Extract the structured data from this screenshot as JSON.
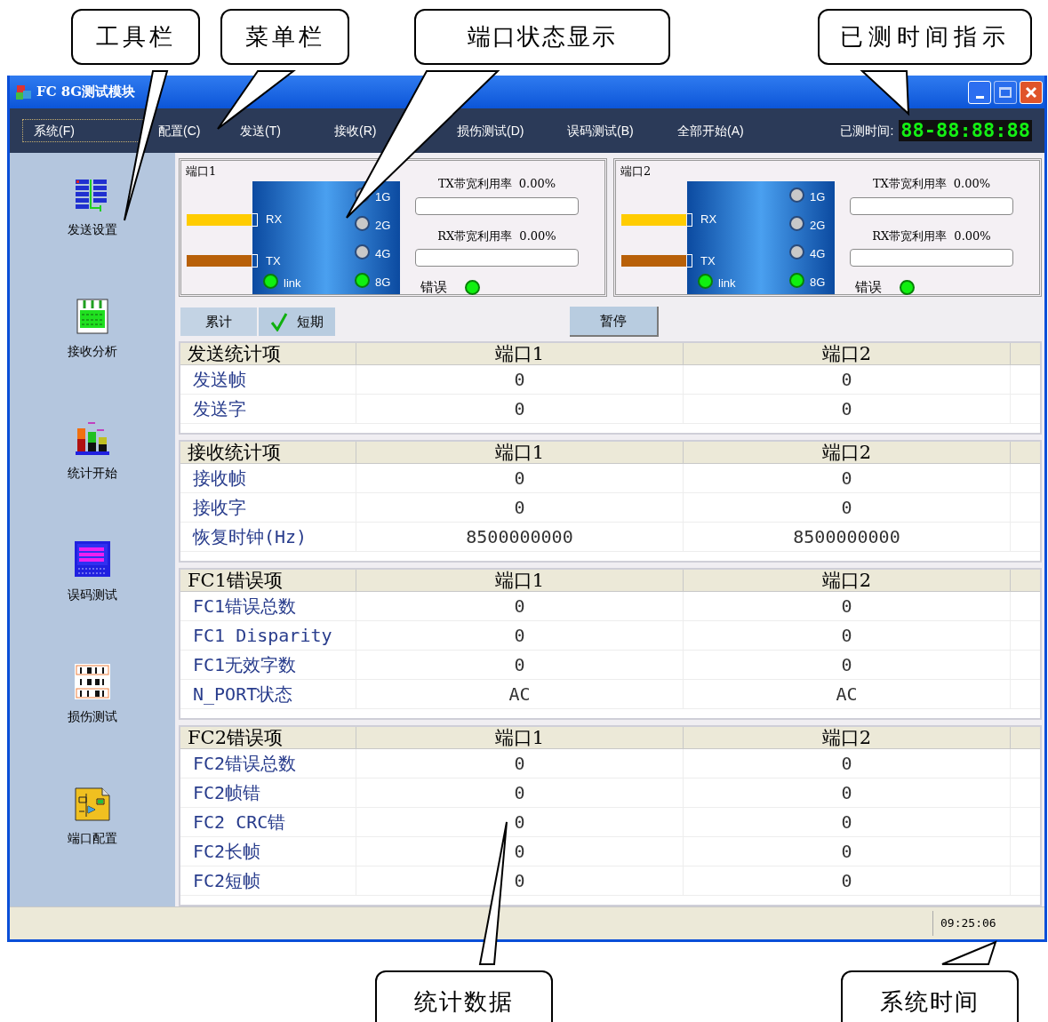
{
  "callouts_top": [
    {
      "label": "工具栏"
    },
    {
      "label": "菜单栏"
    },
    {
      "label": "端口状态显示"
    },
    {
      "label": "已测时间指示"
    }
  ],
  "window": {
    "title": "FC 8G测试模块"
  },
  "menu": [
    {
      "label": "系统(F)",
      "selected": true
    },
    {
      "label": "配置(C)",
      "selected": false
    },
    {
      "label": "发送(T)",
      "selected": false
    },
    {
      "label": "接收(R)",
      "selected": false
    },
    {
      "label": "损伤测试(D)",
      "selected": false
    },
    {
      "label": "误码测试(B)",
      "selected": false
    },
    {
      "label": "全部开始(A)",
      "selected": false
    }
  ],
  "elapsed": {
    "label": "已测时间:",
    "value": "88-88:88:88"
  },
  "toolbar": [
    {
      "label": "发送设置",
      "kind": "send"
    },
    {
      "label": "接收分析",
      "kind": "receive"
    },
    {
      "label": "统计开始",
      "kind": "stats"
    },
    {
      "label": "误码测试",
      "kind": "ber"
    },
    {
      "label": "损伤测试",
      "kind": "impair"
    },
    {
      "label": "端口配置",
      "kind": "port"
    }
  ],
  "ports": [
    {
      "title": "端口1",
      "rx": "RX",
      "tx": "TX",
      "leds": [
        {
          "label": "1G",
          "on": false
        },
        {
          "label": "2G",
          "on": false
        },
        {
          "label": "4G",
          "on": false
        },
        {
          "label": "8G",
          "on": true
        }
      ],
      "link": {
        "label": "link",
        "on": true
      },
      "tx_util": {
        "label": "TX带宽利用率",
        "reading": "0.00%",
        "level": 0
      },
      "rx_util": {
        "label": "RX带宽利用率",
        "reading": "0.00%",
        "level": 0
      },
      "error": {
        "label": "错误",
        "on": true
      }
    },
    {
      "title": "端口2",
      "rx": "RX",
      "tx": "TX",
      "leds": [
        {
          "label": "1G",
          "on": false
        },
        {
          "label": "2G",
          "on": false
        },
        {
          "label": "4G",
          "on": false
        },
        {
          "label": "8G",
          "on": true
        }
      ],
      "link": {
        "label": "link",
        "on": true
      },
      "tx_util": {
        "label": "TX带宽利用率",
        "reading": "0.00%",
        "level": 0
      },
      "rx_util": {
        "label": "RX带宽利用率",
        "reading": "0.00%",
        "level": 0
      },
      "error": {
        "label": "错误",
        "on": true
      }
    }
  ],
  "tabs": [
    {
      "label": "累计",
      "selected": false
    },
    {
      "label": "短期",
      "selected": true
    }
  ],
  "pause_button": "暂停",
  "sections": [
    {
      "columns": [
        "发送统计项",
        "端口1",
        "端口2"
      ],
      "rows": [
        [
          "发送帧",
          "0",
          "0"
        ],
        [
          "发送字",
          "0",
          "0"
        ]
      ]
    },
    {
      "columns": [
        "接收统计项",
        "端口1",
        "端口2"
      ],
      "rows": [
        [
          "接收帧",
          "0",
          "0"
        ],
        [
          "接收字",
          "0",
          "0"
        ],
        [
          "恢复时钟(Hz)",
          "8500000000",
          "8500000000"
        ]
      ]
    },
    {
      "columns": [
        "FC1错误项",
        "端口1",
        "端口2"
      ],
      "rows": [
        [
          "FC1错误总数",
          "0",
          "0"
        ],
        [
          "FC1 Disparity",
          "0",
          "0"
        ],
        [
          "FC1无效字数",
          "0",
          "0"
        ],
        [
          "N_PORT状态",
          "AC",
          "AC"
        ]
      ]
    },
    {
      "columns": [
        "FC2错误项",
        "端口1",
        "端口2"
      ],
      "rows": [
        [
          "FC2错误总数",
          "0",
          "0"
        ],
        [
          "FC2帧错",
          "0",
          "0"
        ],
        [
          "FC2 CRC错",
          "0",
          "0"
        ],
        [
          "FC2长帧",
          "0",
          "0"
        ],
        [
          "FC2短帧",
          "0",
          "0"
        ]
      ]
    }
  ],
  "status_bar": {
    "time": "09:25:06"
  },
  "callouts_bottom": [
    {
      "label": "统计数据"
    },
    {
      "label": "系统时间"
    }
  ]
}
